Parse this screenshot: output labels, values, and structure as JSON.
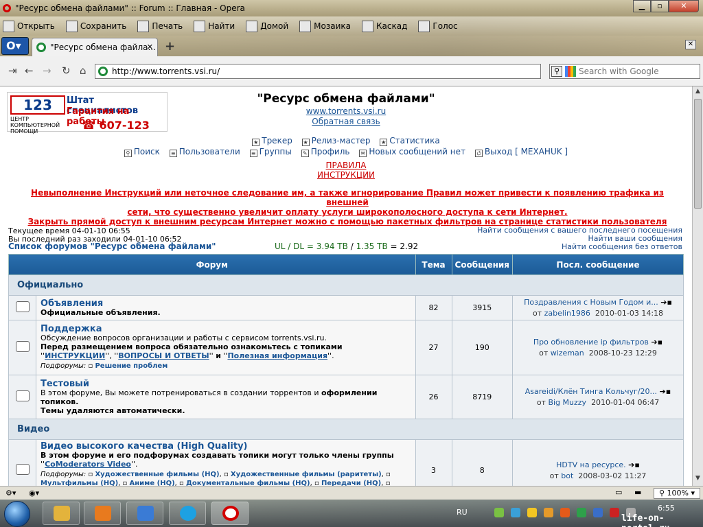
{
  "window": {
    "title": "\"Ресурс обмена файлами\" :: Forum :: Главная - Opera"
  },
  "toolbar": {
    "items": [
      "Открыть",
      "Сохранить",
      "Печать",
      "Найти",
      "Домой",
      "Мозаика",
      "Каскад",
      "Голос"
    ]
  },
  "tabs": [
    {
      "label": "\"Ресурс обмена файла..."
    }
  ],
  "navbar": {
    "url": "http://www.torrents.vsi.ru/",
    "search_placeholder": "Search with Google"
  },
  "header": {
    "logo": {
      "line1": "Штат специалистов",
      "line2": "Гарантия на работы",
      "phone": "☎ 607-123",
      "num": "123",
      "org": "ЦЕНТР КОМПЬЮТЕРНОЙ ПОМОЩИ"
    },
    "title": "\"Ресурс обмена файлами\"",
    "site_link": "www.torrents.vsi.ru",
    "feedback": "Обратная связь"
  },
  "nav1": [
    "Трекер",
    "Релиз-мастер",
    "Статистика"
  ],
  "nav2": [
    "Поиск",
    "Пользователи",
    "Группы",
    "Профиль",
    "Новых сообщений нет",
    "Выход [ МЕХАНUK ]"
  ],
  "rules": {
    "rules": "ПРАВИЛА",
    "instructions": "ИНСТРУКЦИИ"
  },
  "warning": {
    "line1": "Невыполнение Инструкций или неточное следование им, а также игнорирование Правил может привести к появлению трафика из внешней",
    "line2": "сети, что существенно увеличит оплату услуги широкополосного доступа к сети Интернет.",
    "line3": "Закрыть прямой доступ к внешним ресурсам Интернет можно с помощью пакетных фильтров на странице статистики пользователя"
  },
  "meta": {
    "time": "Текущее время 04-01-10 06:55",
    "last_visit": "Вы последний раз заходили 04-01-10 06:52"
  },
  "find_links": [
    "Найти сообщения с вашего последнего посещения",
    "Найти ваши сообщения",
    "Найти сообщения без ответов"
  ],
  "forum_list_title": "Список форумов \"Ресурс обмена файлами\"",
  "ratio": {
    "prefix": "UL / DL =",
    "ul": "3.94 TB",
    "sep": "/",
    "dl": "1.35 TB",
    "eq": "= 2.92"
  },
  "table": {
    "headers": [
      "Форум",
      "Тема",
      "Сообщения",
      "Посл. сообщение"
    ],
    "categories": [
      {
        "name": "Официально"
      },
      {
        "name": "Видео"
      }
    ],
    "rows": [
      {
        "name": "Объявления",
        "desc": "Официальные объявления.",
        "topics": "82",
        "posts": "3915",
        "last_title": "Поздравления с Новым Годом и...",
        "last_by": "от",
        "last_user": "zabelin1986",
        "last_date": "2010-01-03 14:18"
      },
      {
        "name": "Поддержка",
        "desc": "Обсуждение вопросов организации и работы с сервисом torrents.vsi.ru.",
        "desc_bold": "Перед размещением вопроса обязательно ознакомьтесь с топиками",
        "l1": "ИНСТРУКЦИИ",
        "l2": "ВОПРОСЫ И ОТВЕТЫ",
        "l3": "Полезная информация",
        "and": "и",
        "sub_label": "Подфорумы:",
        "sub": "Решение проблем",
        "topics": "27",
        "posts": "190",
        "last_title": "Про обновление ip фильтров",
        "last_by": "от",
        "last_user": "wizeman",
        "last_date": "2008-10-23 12:29"
      },
      {
        "name": "Тестовый",
        "desc": "В этом форуме, Вы можете потренироваться в создании торрентов и",
        "desc_bold": "оформлении топиков.",
        "desc2": "Темы удаляются автоматически.",
        "topics": "26",
        "posts": "8719",
        "last_title": "Asareidi/Клён Тинга Кольчуг/20...",
        "last_by": "от",
        "last_user": "Big Muzzy",
        "last_date": "2010-01-04 06:47"
      },
      {
        "name": "Видео высокого качества (High Quality)",
        "desc_bold": "В этом форуме и его подфорумах создавать топики могут только члены группы",
        "group": "CoModerators Video",
        "sub_label": "Подфорумы:",
        "subs": [
          "Художественные фильмы (HQ)",
          "Художественные фильмы (раритеты)",
          "Мультфильмы (HQ)",
          "Аниме (HQ)",
          "Документальные фильмы (HQ)",
          "Передачи (HQ)"
        ],
        "topics": "3",
        "posts": "8",
        "last_title": "HDTV на ресурсе.",
        "last_by": "от",
        "last_user": "bot",
        "last_date": "2008-03-02 11:27"
      }
    ]
  },
  "statusbar": {
    "zoom": "100%"
  },
  "taskbar": {
    "lang": "RU",
    "time": "6:55",
    "date": "04.01.2010"
  },
  "watermark": "life-on-portal.ru"
}
